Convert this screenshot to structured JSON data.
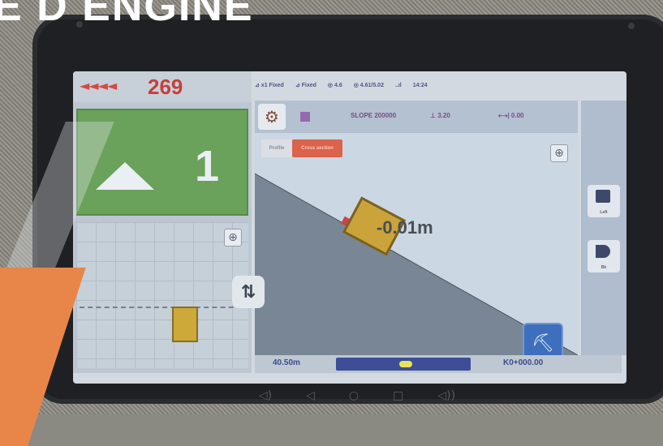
{
  "banner": {
    "text": "E D ENGINE"
  },
  "left_panel": {
    "arrows": "◄◄◄◄",
    "count": "269",
    "guidance_number": "1",
    "locate_icon": "crosshair-icon"
  },
  "swap_button": {
    "icon": "swap-arrows-icon",
    "glyph": "⇅"
  },
  "status_bar": {
    "items": [
      "⊿ x1 Fixed",
      "⊿ Fixed",
      "◎ 4.6",
      "◎ 4.61/5.02",
      "..ıl",
      "14:24"
    ]
  },
  "toolbar": {
    "gear_icon": "⚙",
    "slope_text": "SLOPE 200000",
    "value_1": "⊥ 3.20",
    "value_2": "⟷| 0.00"
  },
  "main_view": {
    "mode_pill_grey": "Profile",
    "mode_pill_red": "Cross section",
    "depth_value": "-0.01m",
    "tool_icon_glyph": "⛏"
  },
  "right_column": {
    "btn1_label": "Left",
    "btn2_label": "Bk"
  },
  "bottom_bar": {
    "left_value": "40.50m",
    "right_value": "K0+000.00"
  },
  "nav": {
    "volume_down": "◁)",
    "back": "◁",
    "home": "○",
    "recent": "□",
    "volume_up": "◁))"
  },
  "colors": {
    "alert_red": "#c0302c",
    "guidance_green": "#5e9a4e",
    "bucket_yellow": "#c69d2b",
    "accent_blue": "#2e63b8",
    "orange_brand": "#e8864a"
  }
}
